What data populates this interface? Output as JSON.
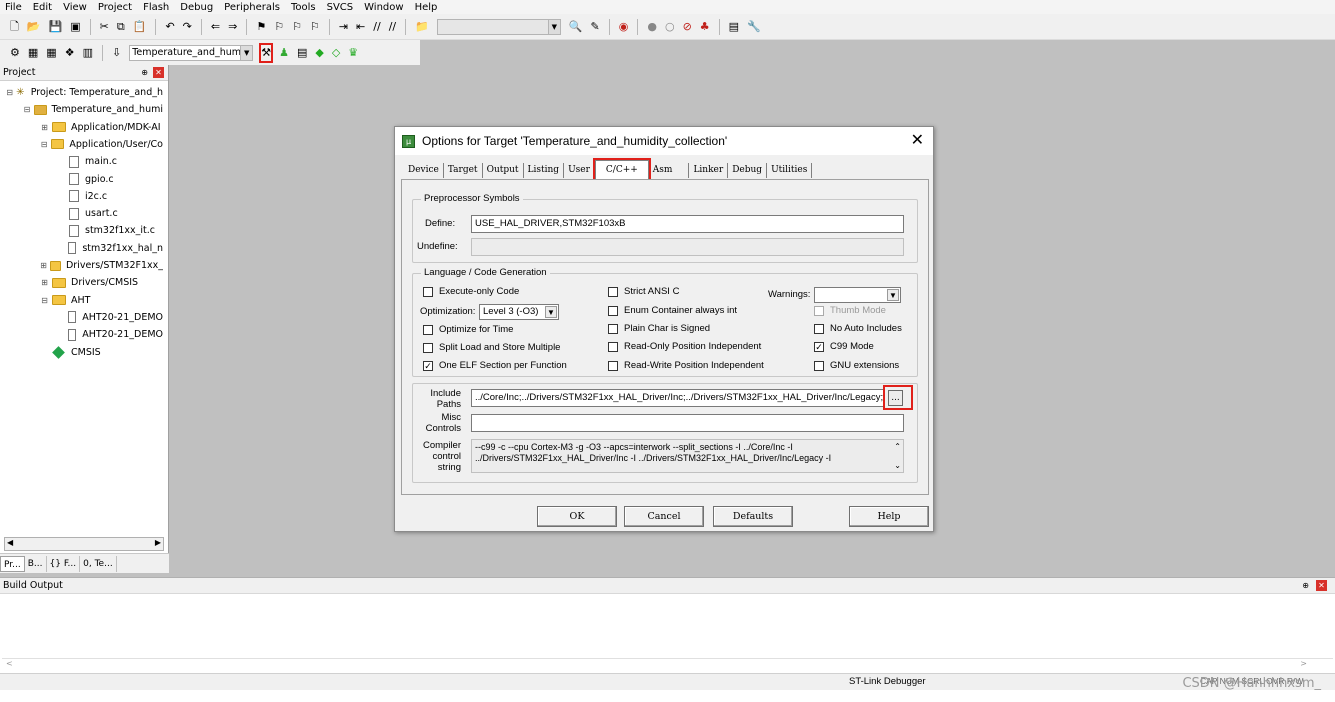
{
  "menu": [
    "File",
    "Edit",
    "View",
    "Project",
    "Flash",
    "Debug",
    "Peripherals",
    "Tools",
    "SVCS",
    "Window",
    "Help"
  ],
  "toolbar": {
    "target_name": "Temperature_and_humid"
  },
  "project_panel": {
    "title": "Project",
    "tree": [
      {
        "label": "Project: Temperature_and_h",
        "indent": 0,
        "kind": "project",
        "exp": "⊟"
      },
      {
        "label": "Temperature_and_humi",
        "indent": 1,
        "kind": "target",
        "exp": "⊟"
      },
      {
        "label": "Application/MDK-AI",
        "indent": 2,
        "kind": "folder",
        "exp": "⊞"
      },
      {
        "label": "Application/User/Co",
        "indent": 2,
        "kind": "folder",
        "exp": "⊟"
      },
      {
        "label": "main.c",
        "indent": 3,
        "kind": "file",
        "exp": ""
      },
      {
        "label": "gpio.c",
        "indent": 3,
        "kind": "file",
        "exp": ""
      },
      {
        "label": "i2c.c",
        "indent": 3,
        "kind": "file",
        "exp": ""
      },
      {
        "label": "usart.c",
        "indent": 3,
        "kind": "file",
        "exp": ""
      },
      {
        "label": "stm32f1xx_it.c",
        "indent": 3,
        "kind": "file",
        "exp": ""
      },
      {
        "label": "stm32f1xx_hal_n",
        "indent": 3,
        "kind": "file",
        "exp": ""
      },
      {
        "label": "Drivers/STM32F1xx_",
        "indent": 2,
        "kind": "folder",
        "exp": "⊞"
      },
      {
        "label": "Drivers/CMSIS",
        "indent": 2,
        "kind": "folder",
        "exp": "⊞"
      },
      {
        "label": "AHT",
        "indent": 2,
        "kind": "folder",
        "exp": "⊟"
      },
      {
        "label": "AHT20-21_DEMO",
        "indent": 3,
        "kind": "file",
        "exp": ""
      },
      {
        "label": "AHT20-21_DEMO",
        "indent": 3,
        "kind": "file",
        "exp": ""
      },
      {
        "label": "CMSIS",
        "indent": 2,
        "kind": "component",
        "exp": ""
      }
    ],
    "tabs": [
      "Pr...",
      "B...",
      "{} F...",
      "0, Te..."
    ]
  },
  "build_output": {
    "title": "Build Output"
  },
  "status": {
    "debugger": "ST-Link Debugger",
    "indicators": "CAP NUM SCRL OVR R/W"
  },
  "watermark": "CSDN @Hanhhhxsm_",
  "dialog": {
    "title": "Options for Target 'Temperature_and_humidity_collection'",
    "close": "✕",
    "tabs": [
      {
        "label": "Device",
        "active": false
      },
      {
        "label": "Target",
        "active": false
      },
      {
        "label": "Output",
        "active": false
      },
      {
        "label": "Listing",
        "active": false
      },
      {
        "label": "User",
        "active": false
      },
      {
        "label": "C/C++",
        "active": true
      },
      {
        "label": "Asm",
        "active": false
      },
      {
        "label": "Linker",
        "active": false
      },
      {
        "label": "Debug",
        "active": false
      },
      {
        "label": "Utilities",
        "active": false
      }
    ],
    "preprocessor": {
      "title": "Preprocessor Symbols",
      "define_label": "Define:",
      "define_value": "USE_HAL_DRIVER,STM32F103xB",
      "undefine_label": "Undefine:",
      "undefine_value": ""
    },
    "language": {
      "title": "Language / Code Generation",
      "execute_only": {
        "label": "Execute-only Code",
        "checked": false
      },
      "optimization_label": "Optimization:",
      "optimization_value": "Level 3 (-O3)",
      "optimize_time": {
        "label": "Optimize for Time",
        "checked": false
      },
      "split_load": {
        "label": "Split Load and Store Multiple",
        "checked": false
      },
      "one_elf": {
        "label": "One ELF Section per Function",
        "checked": true
      },
      "strict_ansi": {
        "label": "Strict ANSI C",
        "checked": false
      },
      "enum_container": {
        "label": "Enum Container always int",
        "checked": false
      },
      "plain_char": {
        "label": "Plain Char is Signed",
        "checked": false
      },
      "ro_pi": {
        "label": "Read-Only Position Independent",
        "checked": false
      },
      "rw_pi": {
        "label": "Read-Write Position Independent",
        "checked": false
      },
      "warnings_label": "Warnings:",
      "warnings_value": "",
      "thumb_mode": {
        "label": "Thumb Mode",
        "checked": false
      },
      "no_auto_includes": {
        "label": "No Auto Includes",
        "checked": false
      },
      "c99_mode": {
        "label": "C99 Mode",
        "checked": true
      },
      "gnu_ext": {
        "label": "GNU extensions",
        "checked": false
      }
    },
    "include_paths_label": "Include\nPaths",
    "include_paths_value": "../Core/Inc;../Drivers/STM32F1xx_HAL_Driver/Inc;../Drivers/STM32F1xx_HAL_Driver/Inc/Legacy;../Driv",
    "browse_label": "...",
    "misc_label": "Misc\nControls",
    "misc_value": "",
    "compiler_label": "Compiler\ncontrol\nstring",
    "compiler_value": "--c99 -c --cpu Cortex-M3 -g -O3 --apcs=interwork --split_sections -I ../Core/Inc -I ../Drivers/STM32F1xx_HAL_Driver/Inc -I ../Drivers/STM32F1xx_HAL_Driver/Inc/Legacy -I",
    "buttons": {
      "ok": "OK",
      "cancel": "Cancel",
      "defaults": "Defaults",
      "help": "Help"
    }
  }
}
